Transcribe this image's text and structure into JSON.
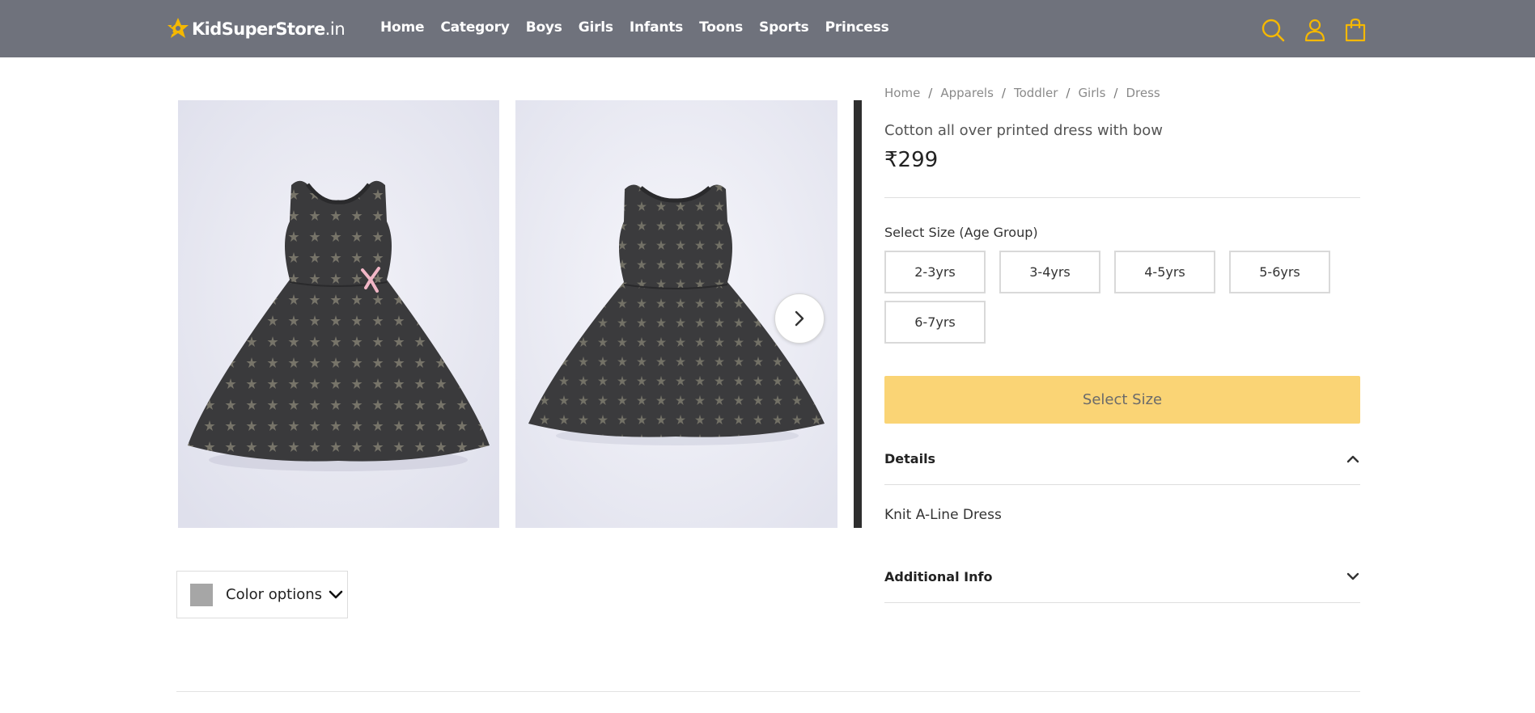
{
  "header": {
    "logo": {
      "name": "KidSuperStore",
      "tld": ".in",
      "icon": "star-logo-icon"
    },
    "nav": [
      "Home",
      "Category",
      "Boys",
      "Girls",
      "Infants",
      "Toons",
      "Sports",
      "Princess"
    ],
    "icons": [
      "search-icon",
      "user-icon",
      "bag-icon"
    ],
    "bg_color": "#6f727c",
    "accent_color": "#f5b800"
  },
  "gallery": {
    "images": [
      "dress-front-image",
      "dress-back-image",
      "dress-detail-image"
    ],
    "next_icon": "chevron-right-icon",
    "color_options": {
      "label": "Color options",
      "swatch_color": "#a6a6a6",
      "icon": "chevron-down-icon"
    }
  },
  "product": {
    "breadcrumb": [
      "Home",
      "Apparels",
      "Toddler",
      "Girls",
      "Dress"
    ],
    "title": "Cotton all over printed dress with bow",
    "price": "₹299",
    "size_label": "Select Size (Age Group)",
    "sizes": [
      "2-3yrs",
      "3-4yrs",
      "4-5yrs",
      "5-6yrs",
      "6-7yrs"
    ],
    "cta_label": "Select Size",
    "cta_color": "#fad475",
    "details": {
      "title": "Details",
      "body": "Knit A-Line Dress",
      "icon": "chevron-up-icon",
      "expanded": true
    },
    "additional": {
      "title": "Additional Info",
      "icon": "chevron-down-icon",
      "expanded": false
    }
  }
}
